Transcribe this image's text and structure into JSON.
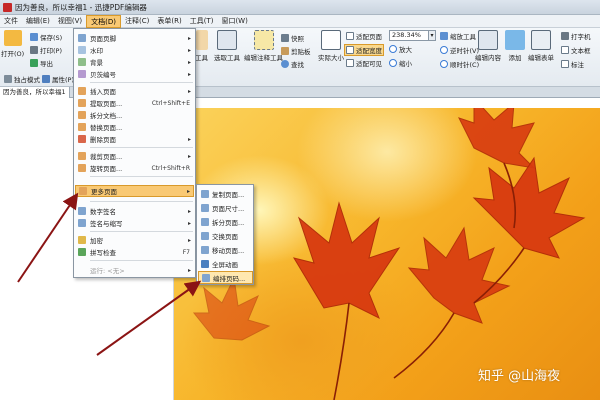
{
  "window": {
    "title": "因为善良，所以幸福1 - 迅捷PDF编辑器"
  },
  "menubar": {
    "items": [
      "文件",
      "编辑(E)",
      "视图(V)",
      "文档(D)",
      "注释(C)",
      "表单(R)",
      "工具(T)",
      "窗口(W)"
    ],
    "active_index": 3
  },
  "ribbon": {
    "open": "打开(O)",
    "save": "保存(S)",
    "print": "打印(P)",
    "export": "导出",
    "exclusive_mode": "独占模式",
    "properties": "属性(P)",
    "tool_truncated": "工具",
    "select_tool": "选取工具",
    "edit_annotation_tool": "编辑注释工具",
    "snapshot": "快照",
    "clipboard": "剪贴板",
    "find": "查找",
    "actual_size": "实际大小",
    "fit_page": "适配页面",
    "fit_width": "适配宽度",
    "fit_visible": "适配可见",
    "zoom_value": "238.34%",
    "zoom_in": "放大",
    "zoom_out": "缩小",
    "zoom_tool": "缩放工具",
    "rotate_ccw": "逆时针(V)",
    "rotate_cw": "顺时针(C)",
    "edit_content": "编辑内容",
    "add": "添加",
    "edit_form": "编辑表单",
    "typewriter": "打字机",
    "textbox": "文本框",
    "callout": "标注"
  },
  "doc_tab": {
    "label": "因为善良，所以幸福1"
  },
  "document_menu": {
    "items": [
      {
        "label": "页面页脚",
        "arrow": "▸"
      },
      {
        "label": "水印",
        "arrow": "▸"
      },
      {
        "label": "背景",
        "arrow": "▸"
      },
      {
        "label": "贝茨编号",
        "arrow": "▸"
      },
      {
        "label": "插入页面",
        "arrow": "▸"
      },
      {
        "label": "提取页面...",
        "shortcut": "Ctrl+Shift+E"
      },
      {
        "label": "拆分文档..."
      },
      {
        "label": "替换页面..."
      },
      {
        "label": "删除页面",
        "arrow": "▸"
      },
      {
        "label": "裁剪页面...",
        "arrow": "▸"
      },
      {
        "label": "旋转页面...",
        "shortcut": "Ctrl+Shift+R"
      },
      {
        "label": "更多页面",
        "arrow": "▸"
      },
      {
        "label": "数字签名",
        "arrow": "▸"
      },
      {
        "label": "签名与缩写",
        "arrow": "▸"
      },
      {
        "label": "加密",
        "arrow": "▸"
      },
      {
        "label": "拼写检查",
        "shortcut": "F7"
      },
      {
        "label": "运行: <无>",
        "arrow": "▸"
      }
    ]
  },
  "more_pages_submenu": {
    "items": [
      "复制页面...",
      "页面尺寸...",
      "拆分页面...",
      "交换页面",
      "移动页面...",
      "全屏动画",
      "编排页码..."
    ]
  },
  "watermark": {
    "text": "知乎 @山海夜"
  }
}
